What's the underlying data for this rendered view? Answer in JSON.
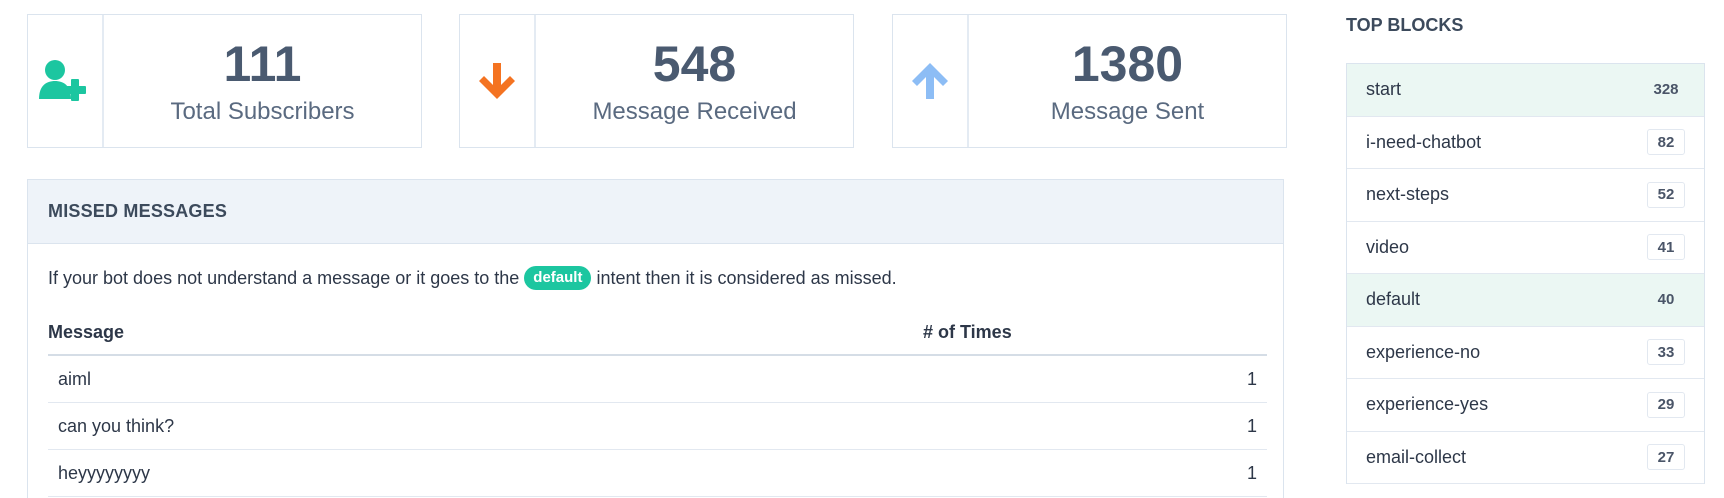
{
  "stats": [
    {
      "value": "111",
      "label": "Total Subscribers",
      "icon": "add-user-icon",
      "color": "#1cc6a0"
    },
    {
      "value": "548",
      "label": "Message Received",
      "icon": "arrow-down-icon",
      "color": "#f47321"
    },
    {
      "value": "1380",
      "label": "Message Sent",
      "icon": "arrow-up-icon",
      "color": "#8dbdf5"
    }
  ],
  "missed": {
    "title": "MISSED MESSAGES",
    "desc_before": "If your bot does not understand a message or it goes to the",
    "badge": "default",
    "desc_after": "intent then it is considered as missed.",
    "col_message": "Message",
    "col_times": "# of Times",
    "rows": [
      {
        "message": "aiml",
        "times": "1"
      },
      {
        "message": "can you think?",
        "times": "1"
      },
      {
        "message": "heyyyyyyyy",
        "times": "1"
      }
    ]
  },
  "top_blocks": {
    "title": "TOP BLOCKS",
    "items": [
      {
        "name": "start",
        "count": "328"
      },
      {
        "name": "i-need-chatbot",
        "count": "82"
      },
      {
        "name": "next-steps",
        "count": "52"
      },
      {
        "name": "video",
        "count": "41"
      },
      {
        "name": "default",
        "count": "40"
      },
      {
        "name": "experience-no",
        "count": "33"
      },
      {
        "name": "experience-yes",
        "count": "29"
      },
      {
        "name": "email-collect",
        "count": "27"
      }
    ]
  }
}
